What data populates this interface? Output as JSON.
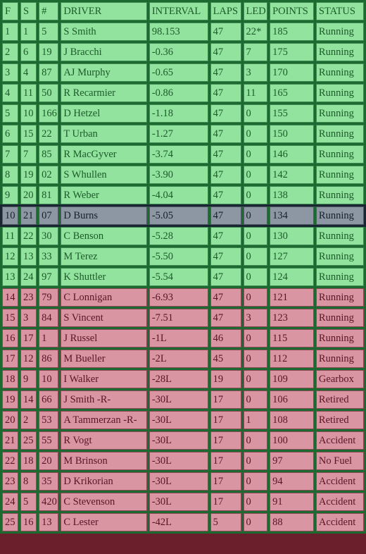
{
  "table": {
    "headers": [
      "F",
      "S",
      "#",
      "DRIVER",
      "INTERVAL",
      "LAPS",
      "LED",
      "POINTS",
      "STATUS"
    ],
    "rows": [
      {
        "zone": "green",
        "cells": [
          "1",
          "1",
          "5",
          "S Smith",
          "98.153",
          "47",
          "22*",
          "185",
          "Running"
        ]
      },
      {
        "zone": "green",
        "cells": [
          "2",
          "6",
          "19",
          "J Bracchi",
          "-0.36",
          "47",
          "7",
          "175",
          "Running"
        ]
      },
      {
        "zone": "green",
        "cells": [
          "3",
          "4",
          "87",
          "AJ Murphy",
          "-0.65",
          "47",
          "3",
          "170",
          "Running"
        ]
      },
      {
        "zone": "green",
        "cells": [
          "4",
          "11",
          "50",
          "R Recarmier",
          "-0.86",
          "47",
          "11",
          "165",
          "Running"
        ]
      },
      {
        "zone": "green",
        "cells": [
          "5",
          "10",
          "166",
          "D Hetzel",
          "-1.18",
          "47",
          "0",
          "155",
          "Running"
        ]
      },
      {
        "zone": "green",
        "cells": [
          "6",
          "15",
          "22",
          "T Urban",
          "-1.27",
          "47",
          "0",
          "150",
          "Running"
        ]
      },
      {
        "zone": "green",
        "cells": [
          "7",
          "7",
          "85",
          "R MacGyver",
          "-3.74",
          "47",
          "0",
          "146",
          "Running"
        ]
      },
      {
        "zone": "green",
        "cells": [
          "8",
          "19",
          "02",
          "S Whullen",
          "-3.90",
          "47",
          "0",
          "142",
          "Running"
        ]
      },
      {
        "zone": "green",
        "cells": [
          "9",
          "20",
          "81",
          "R Weber",
          "-4.04",
          "47",
          "0",
          "138",
          "Running"
        ]
      },
      {
        "zone": "gray",
        "cells": [
          "10",
          "21",
          "07",
          "D Burns",
          "-5.05",
          "47",
          "0",
          "134",
          "Running"
        ]
      },
      {
        "zone": "green",
        "cells": [
          "11",
          "22",
          "30",
          "C Benson",
          "-5.28",
          "47",
          "0",
          "130",
          "Running"
        ]
      },
      {
        "zone": "green",
        "cells": [
          "12",
          "13",
          "33",
          "M Terez",
          "-5.50",
          "47",
          "0",
          "127",
          "Running"
        ]
      },
      {
        "zone": "green",
        "cells": [
          "13",
          "24",
          "97",
          "K Shuttler",
          "-5.54",
          "47",
          "0",
          "124",
          "Running"
        ]
      },
      {
        "zone": "red",
        "cells": [
          "14",
          "23",
          "79",
          "C Lonnigan",
          "-6.93",
          "47",
          "0",
          "121",
          "Running"
        ]
      },
      {
        "zone": "red",
        "cells": [
          "15",
          "3",
          "84",
          "S Vincent",
          "-7.51",
          "47",
          "3",
          "123",
          "Running"
        ]
      },
      {
        "zone": "red",
        "cells": [
          "16",
          "17",
          "1",
          "J Russel",
          "-1L",
          "46",
          "0",
          "115",
          "Running"
        ]
      },
      {
        "zone": "red",
        "cells": [
          "17",
          "12",
          "86",
          "M Bueller",
          "-2L",
          "45",
          "0",
          "112",
          "Running"
        ]
      },
      {
        "zone": "red",
        "cells": [
          "18",
          "9",
          "10",
          "I Walker",
          "-28L",
          "19",
          "0",
          "109",
          "Gearbox"
        ]
      },
      {
        "zone": "red",
        "cells": [
          "19",
          "14",
          "66",
          "J Smith -R-",
          "-30L",
          "17",
          "0",
          "106",
          "Retired"
        ]
      },
      {
        "zone": "red",
        "cells": [
          "20",
          "2",
          "53",
          "A Tammerzan -R-",
          "-30L",
          "17",
          "1",
          "108",
          "Retired"
        ]
      },
      {
        "zone": "red",
        "cells": [
          "21",
          "25",
          "55",
          "R Vogt",
          "-30L",
          "17",
          "0",
          "100",
          "Accident"
        ]
      },
      {
        "zone": "red",
        "cells": [
          "22",
          "18",
          "20",
          "M Brinson",
          "-30L",
          "17",
          "0",
          "97",
          "No Fuel"
        ]
      },
      {
        "zone": "red",
        "cells": [
          "23",
          "8",
          "35",
          "D Krikorian",
          "-30L",
          "17",
          "0",
          "94",
          "Accident"
        ]
      },
      {
        "zone": "red",
        "cells": [
          "24",
          "5",
          "420",
          "C Stevenson",
          "-30L",
          "17",
          "0",
          "91",
          "Accident"
        ]
      },
      {
        "zone": "red",
        "cells": [
          "25",
          "16",
          "13",
          "C Lester",
          "-42L",
          "5",
          "0",
          "88",
          "Accident"
        ]
      }
    ]
  },
  "colors": {
    "green_cell": "#92e39e",
    "green_border": "#1c6a30",
    "gray_cell": "#8d96a3",
    "gray_border": "#1a2733",
    "red_cell": "#da95a2",
    "red_border": "#6b1f2c"
  }
}
